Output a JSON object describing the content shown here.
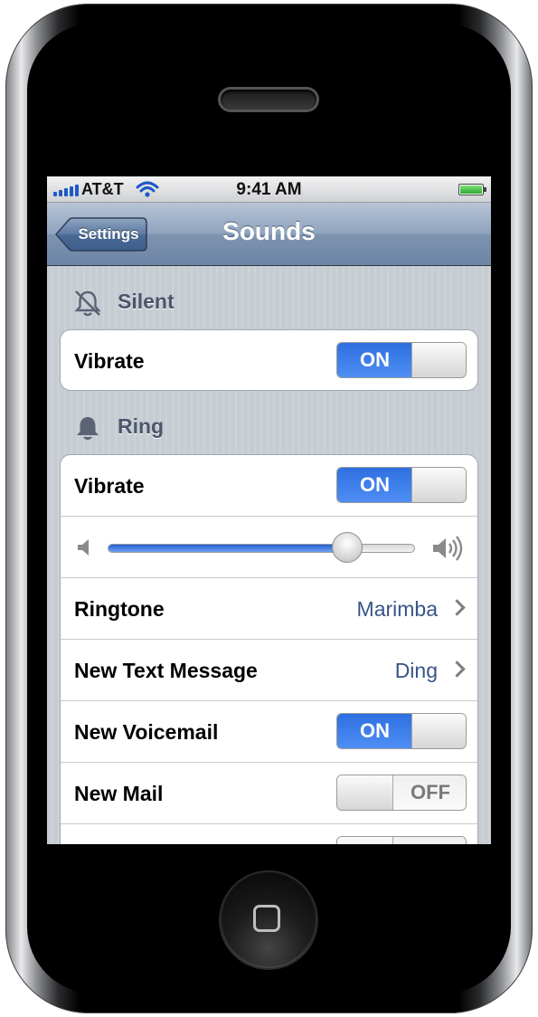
{
  "status_bar": {
    "carrier": "AT&T",
    "time": "9:41 AM"
  },
  "nav": {
    "back_label": "Settings",
    "title": "Sounds"
  },
  "silent_section": {
    "header": "Silent",
    "icon": "bell-slash-icon",
    "vibrate": {
      "label": "Vibrate",
      "state": "ON"
    }
  },
  "ring_section": {
    "header": "Ring",
    "icon": "bell-icon",
    "vibrate": {
      "label": "Vibrate",
      "state": "ON"
    },
    "volume": {
      "level": 0.78,
      "low_icon": "speaker-low-icon",
      "high_icon": "speaker-high-icon"
    },
    "ringtone": {
      "label": "Ringtone",
      "value": "Marimba"
    },
    "new_text_message": {
      "label": "New Text Message",
      "value": "Ding"
    },
    "new_voicemail": {
      "label": "New Voicemail",
      "state": "ON"
    },
    "new_mail": {
      "label": "New Mail",
      "state": "OFF"
    }
  },
  "colors": {
    "switch_on": "#2f6fe0",
    "value_text": "#385487",
    "nav_bar": "#7d93b0"
  }
}
